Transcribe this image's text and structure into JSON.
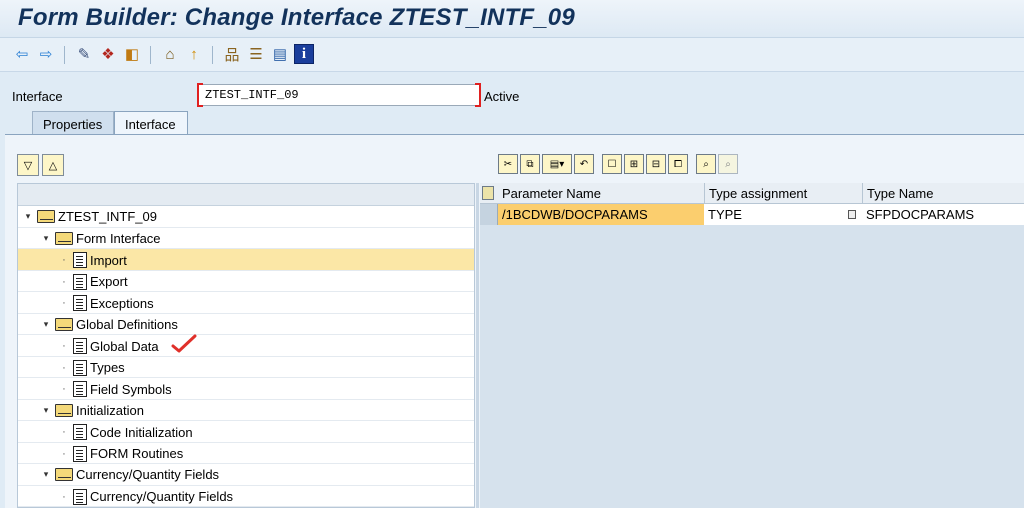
{
  "window": {
    "title": "Form Builder: Change Interface ZTEST_INTF_09"
  },
  "toolbar": {
    "buttons": [
      {
        "name": "back-arrow-icon",
        "glyph": "⇦",
        "color": "#2a7fd4"
      },
      {
        "name": "forward-arrow-icon",
        "glyph": "⇨",
        "color": "#2a7fd4"
      },
      {
        "name": "display-change-icon",
        "glyph": "✎",
        "color": "#3a4f7a"
      },
      {
        "name": "check-icon",
        "glyph": "❖",
        "color": "#b3261e"
      },
      {
        "name": "activate-icon",
        "glyph": "◧",
        "color": "#c07a12"
      },
      {
        "name": "where-used-icon",
        "glyph": "⌂",
        "color": "#7a5a1a"
      },
      {
        "name": "info-marker-icon",
        "glyph": "↑",
        "color": "#d08a00"
      },
      {
        "name": "hierarchy-icon",
        "glyph": "品",
        "color": "#8a6420"
      },
      {
        "name": "stack-icon",
        "glyph": "☰",
        "color": "#8a6420"
      },
      {
        "name": "layout-icon",
        "glyph": "▤",
        "color": "#2b5fa5"
      },
      {
        "name": "information-icon",
        "glyph": "i",
        "color": "#1a3e9c"
      }
    ]
  },
  "interface_field": {
    "label": "Interface",
    "value": "ZTEST_INTF_09",
    "status": "Active"
  },
  "tabs": [
    {
      "label": "Properties",
      "active": false
    },
    {
      "label": "Interface",
      "active": true
    }
  ],
  "tree": {
    "items": [
      {
        "label": "ZTEST_INTF_09",
        "kind": "folder",
        "level": 0,
        "selected": false
      },
      {
        "label": "Form Interface",
        "kind": "folder",
        "level": 1,
        "selected": false
      },
      {
        "label": "Import",
        "kind": "doc",
        "level": 2,
        "selected": true
      },
      {
        "label": "Export",
        "kind": "doc",
        "level": 2,
        "selected": false
      },
      {
        "label": "Exceptions",
        "kind": "doc",
        "level": 2,
        "selected": false
      },
      {
        "label": "Global Definitions",
        "kind": "folder",
        "level": 1,
        "selected": false
      },
      {
        "label": "Global Data",
        "kind": "doc",
        "level": 2,
        "selected": false
      },
      {
        "label": "Types",
        "kind": "doc",
        "level": 2,
        "selected": false
      },
      {
        "label": "Field Symbols",
        "kind": "doc",
        "level": 2,
        "selected": false
      },
      {
        "label": "Initialization",
        "kind": "folder",
        "level": 1,
        "selected": false
      },
      {
        "label": "Code Initialization",
        "kind": "doc",
        "level": 2,
        "selected": false
      },
      {
        "label": "FORM Routines",
        "kind": "doc",
        "level": 2,
        "selected": false
      },
      {
        "label": "Currency/Quantity Fields",
        "kind": "folder",
        "level": 1,
        "selected": false
      },
      {
        "label": "Currency/Quantity Fields",
        "kind": "doc",
        "level": 2,
        "selected": false
      }
    ]
  },
  "grid": {
    "columns": [
      "Parameter Name",
      "Type assignment",
      "Type Name"
    ],
    "rows": [
      {
        "parameter_name": "/1BCDWB/DOCPARAMS",
        "type_assignment": "TYPE",
        "type_name": "SFPDOCPARAMS"
      }
    ]
  }
}
